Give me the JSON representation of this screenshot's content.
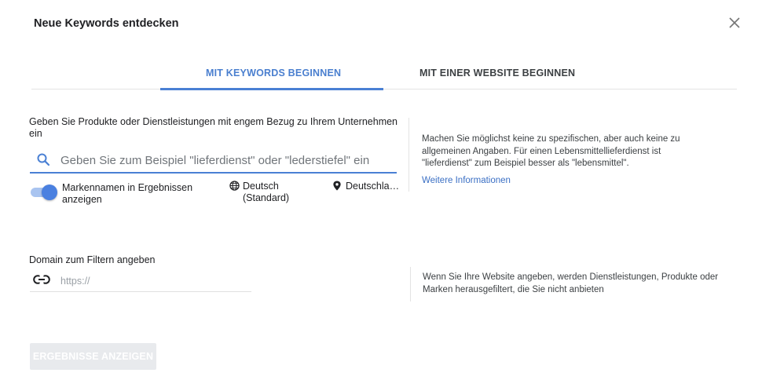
{
  "dialog": {
    "title": "Neue Keywords entdecken"
  },
  "tabs": [
    {
      "label": "MIT KEYWORDS BEGINNEN",
      "active": true
    },
    {
      "label": "MIT EINER WEBSITE BEGINNEN",
      "active": false
    }
  ],
  "keywords_section": {
    "label": "Geben Sie Produkte oder Dienstleistungen mit engem Bezug zu Ihrem Unternehmen ein",
    "search_placeholder": "Geben Sie zum Beispiel \"lieferdienst\" oder \"lederstiefel\" ein",
    "toggle": {
      "label": "Markennamen in Ergebnissen anzeigen",
      "on": true
    },
    "language": "Deutsch (Standard)",
    "location": "Deutschla…",
    "help_text": "Machen Sie möglichst keine zu spezifischen, aber auch keine zu allgemeinen Angaben. Für einen Lebensmittellieferdienst ist \"lieferdienst\" zum Beispiel besser als \"lebensmittel\".",
    "help_link": "Weitere Informationen"
  },
  "domain_section": {
    "label": "Domain zum Filtern angeben",
    "placeholder": "https://",
    "help_text": "Wenn Sie Ihre Website angeben, werden Dienstleistungen, Produkte oder Marken herausgefiltert, die Sie nicht anbieten"
  },
  "submit_label": "ERGEBNISSE ANZEIGEN",
  "colors": {
    "accent": "#4a80d4",
    "link": "#3a6fc4",
    "disabled_button": "#e8eaed"
  }
}
